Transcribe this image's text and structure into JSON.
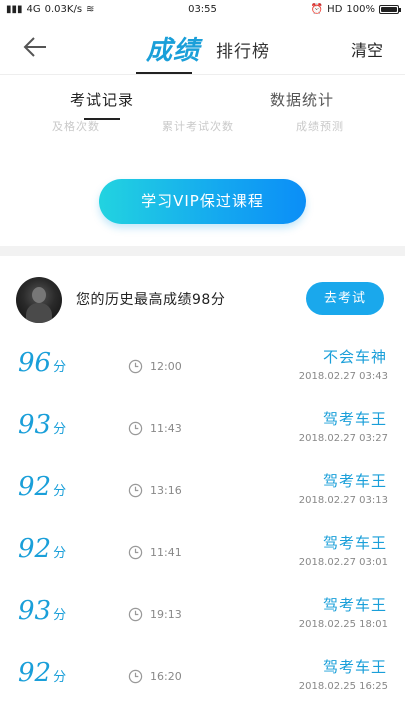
{
  "status_bar": {
    "carrier": "4G",
    "speed": "0.03K/s",
    "time": "03:55",
    "hd": "HD",
    "battery": "100%",
    "battery_level": 1.0
  },
  "nav": {
    "tabs": [
      "成绩",
      "排行榜"
    ],
    "clear_label": "清空"
  },
  "subtabs": [
    "考试记录",
    "数据统计"
  ],
  "cut_labels": [
    "及格次数",
    "累计考试次数",
    "成绩预测"
  ],
  "vip_button_label": "学习VIP保过课程",
  "best": {
    "text": "您的历史最高成绩98分",
    "button_label": "去考试"
  },
  "records": [
    {
      "score": "96",
      "unit": "分",
      "duration": "12:00",
      "title": "不会车神",
      "datetime": "2018.02.27  03:43"
    },
    {
      "score": "93",
      "unit": "分",
      "duration": "11:43",
      "title": "驾考车王",
      "datetime": "2018.02.27  03:27"
    },
    {
      "score": "92",
      "unit": "分",
      "duration": "13:16",
      "title": "驾考车王",
      "datetime": "2018.02.27  03:13"
    },
    {
      "score": "92",
      "unit": "分",
      "duration": "11:41",
      "title": "驾考车王",
      "datetime": "2018.02.27  03:01"
    },
    {
      "score": "93",
      "unit": "分",
      "duration": "19:13",
      "title": "驾考车王",
      "datetime": "2018.02.25  18:01"
    },
    {
      "score": "92",
      "unit": "分",
      "duration": "16:20",
      "title": "驾考车王",
      "datetime": "2018.02.25  16:25"
    }
  ]
}
